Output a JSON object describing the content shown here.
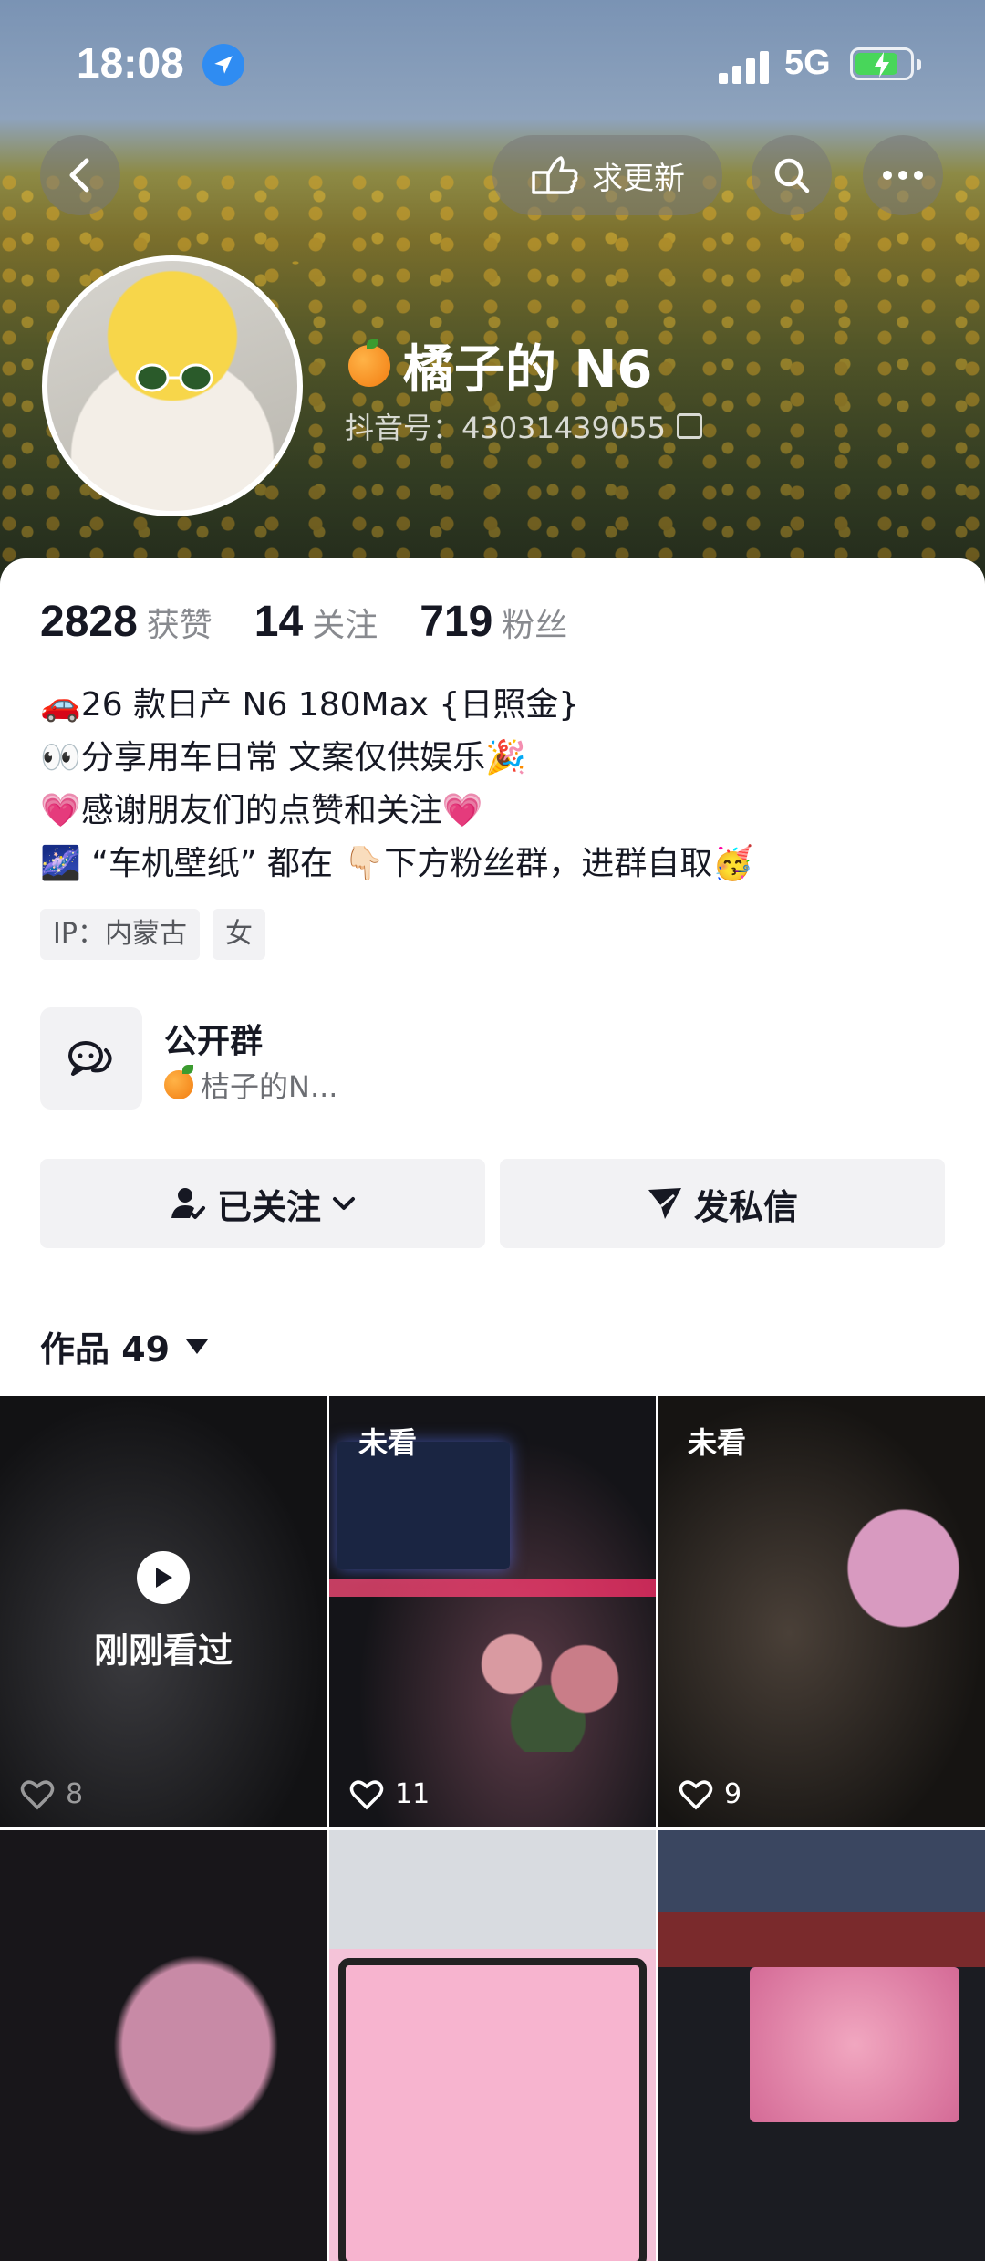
{
  "status_bar": {
    "time": "18:08",
    "network": "5G"
  },
  "nav": {
    "request_update": "求更新"
  },
  "profile": {
    "nickname": "橘子的 N6",
    "douyin_id": "抖音号：43031439055"
  },
  "stats": [
    {
      "value": "2828",
      "label": "获赞"
    },
    {
      "value": "14",
      "label": "关注"
    },
    {
      "value": "719",
      "label": "粉丝"
    }
  ],
  "bio": [
    "🚗26 款日产 N6 180Max {日照金}",
    "👀分享用车日常  文案仅供娱乐🎉",
    "💗感谢朋友们的点赞和关注💗",
    "🌌 “车机壁纸” 都在 👇🏻下方粉丝群，进群自取🥳"
  ],
  "tags": [
    "IP：内蒙古",
    "女"
  ],
  "group": {
    "title": "公开群",
    "subtitle": "桔子的N..."
  },
  "buttons": {
    "following": "已关注",
    "message": "发私信"
  },
  "works": {
    "label": "作品 49"
  },
  "grid": [
    {
      "badge": "",
      "overlay": "刚刚看过",
      "likes": "8"
    },
    {
      "badge": "未看",
      "overlay": "",
      "likes": "11"
    },
    {
      "badge": "未看",
      "overlay": "",
      "likes": "9"
    },
    {
      "badge": "",
      "overlay": "",
      "likes": ""
    },
    {
      "badge": "",
      "overlay": "",
      "likes": ""
    },
    {
      "badge": "",
      "overlay": "",
      "likes": ""
    }
  ],
  "icons": [
    "back-icon",
    "hand-point-icon",
    "search-icon",
    "more-icon",
    "location-icon",
    "chat-bubbles-icon",
    "user-check-icon",
    "chevron-down-icon",
    "send-icon",
    "heart-icon",
    "play-icon"
  ]
}
